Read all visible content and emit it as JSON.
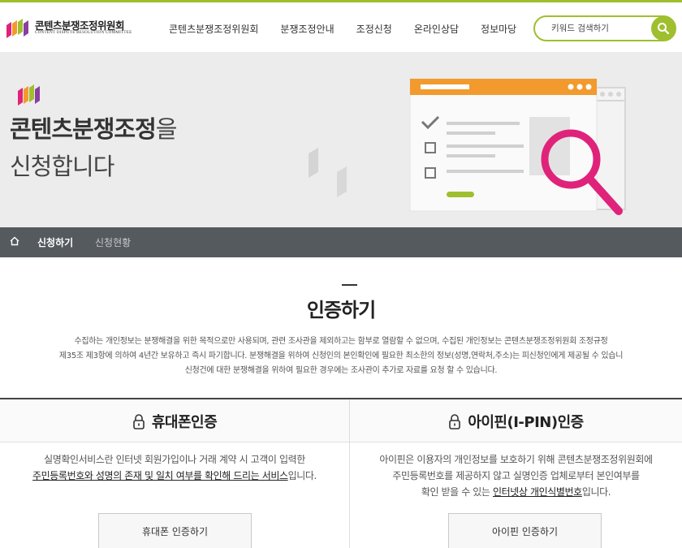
{
  "header": {
    "logo_title": "콘텐츠분쟁조정위원회",
    "logo_subtitle": "CONTENT DISPUTE RESOLUTION COMMITTEE",
    "nav": [
      "콘텐츠분쟁조정위원회",
      "분쟁조정안내",
      "조정신청",
      "온라인상담",
      "정보마당"
    ],
    "search_placeholder": "키워드 검색하기",
    "search_icon": "search-icon"
  },
  "banner": {
    "line1_bold": "콘텐츠분쟁조정",
    "line1_rest": "을",
    "line2": "신청합니다"
  },
  "subnav": {
    "home_icon": "home-icon",
    "active": "신청하기",
    "other": "신청현황"
  },
  "main": {
    "title": "인증하기",
    "notice": [
      "수집하는 개인정보는 분쟁해결을 위한 목적으로만 사용되며, 관련 조사관을 제외하고는 함부로 열람할 수 없으며, 수집된 개인정보는 콘텐츠분쟁조정위원회 조정규정",
      "제35조 제3항에 의하여 4년간 보유하고 즉시 파기합니다. 분쟁해결을 위하여 신청인의 본인확인에 필요한 최소한의 정보(성명,연락처,주소)는 피신청인에게 제공될 수 있습니",
      "신청건에 대한 분쟁해결을 위하여 필요한 경우에는 조사관이 추가로 자료를 요청 할 수 있습니다."
    ]
  },
  "cards": {
    "phone": {
      "title": "휴대폰인증",
      "line1": "실명확인서비스란 인터넷 회원가입이나 거래 계약 시 고객이 입력한",
      "line2_u": "주민등록번호와 성명의 존재 및 일치 여부를 확인해 드리는 서비스",
      "line2_rest": "입니다.",
      "button": "휴대폰 인증하기"
    },
    "ipin": {
      "title": "아이핀(I-PIN)인증",
      "line1": "아이핀은 이용자의 개인정보를 보호하기 위해 콘텐츠분쟁조정위원회에",
      "line2": "주민등록번호를 제공하지 않고 실명인증 업체로부터 본인여부를",
      "line3_pre": "확인 받을 수 있는 ",
      "line3_u": "인터넷상 개인식별번호",
      "line3_rest": "입니다.",
      "button": "아이핀 인증하기"
    }
  },
  "colors": {
    "accent_green": "#9fbf2e",
    "subnav_bg": "#555a5f",
    "illustration_orange": "#f29a2e",
    "magnifier_pink": "#e0237a"
  }
}
